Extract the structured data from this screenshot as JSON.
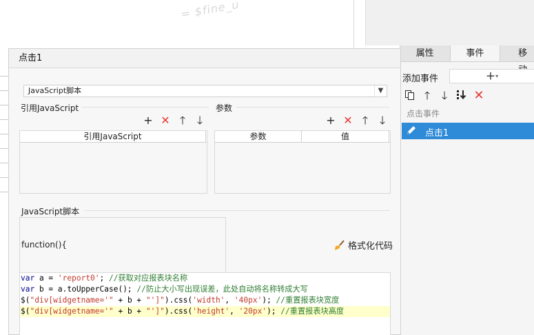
{
  "background": {
    "watermark": "= $fine_u"
  },
  "right_panel": {
    "tabs": [
      "属性",
      "事件",
      "移动"
    ],
    "active_tab": "事件",
    "add_event_label": "添加事件",
    "add_event_button": "+",
    "toolbar_icons": [
      "copy-icon",
      "arrow-up-icon",
      "arrow-down-icon",
      "move-bottom-icon",
      "delete-icon"
    ],
    "section_label": "点击事件",
    "events": [
      {
        "label": "点击1",
        "selected": true
      }
    ],
    "selection_color": "#2f8bd8"
  },
  "dialog": {
    "title": "点击1",
    "type_select": {
      "value": "JavaScript脚本"
    },
    "ref_js": {
      "section_label": "引用JavaScript",
      "column": "引用JavaScript"
    },
    "params": {
      "section_label": "参数",
      "columns": [
        "参数",
        "值"
      ]
    },
    "script": {
      "section_label": "JavaScript脚本",
      "function_header": "function(){",
      "format_button": "格式化代码",
      "code_lines": [
        [
          {
            "t": "var",
            "c": "kw"
          },
          {
            "t": " a = ",
            "c": "fnname"
          },
          {
            "t": "'report0'",
            "c": "str"
          },
          {
            "t": "; ",
            "c": "fnname"
          },
          {
            "t": "//获取对应报表块名称",
            "c": "cm"
          }
        ],
        [
          {
            "t": "var",
            "c": "kw"
          },
          {
            "t": " b = a.toUpperCase(); ",
            "c": "fnname"
          },
          {
            "t": "//防止大小写出现误差，此处自动将名称转成大写",
            "c": "cm"
          }
        ],
        [
          {
            "t": "$(",
            "c": "fnname"
          },
          {
            "t": "\"div[widgetname='\"",
            "c": "str"
          },
          {
            "t": " + b + ",
            "c": "fnname"
          },
          {
            "t": "\"']\"",
            "c": "str"
          },
          {
            "t": ").css(",
            "c": "fnname"
          },
          {
            "t": "'width'",
            "c": "str"
          },
          {
            "t": ", ",
            "c": "fnname"
          },
          {
            "t": "'40px'",
            "c": "str"
          },
          {
            "t": "); ",
            "c": "fnname"
          },
          {
            "t": "//重置报表块宽度",
            "c": "cm"
          }
        ],
        [
          {
            "t": "$(",
            "c": "fnname"
          },
          {
            "t": "\"div[widgetname='\"",
            "c": "str"
          },
          {
            "t": " + b + ",
            "c": "fnname"
          },
          {
            "t": "\"']\"",
            "c": "str"
          },
          {
            "t": ").css(",
            "c": "fnname"
          },
          {
            "t": "'height'",
            "c": "str"
          },
          {
            "t": ", ",
            "c": "fnname"
          },
          {
            "t": "'20px'",
            "c": "str"
          },
          {
            "t": "); ",
            "c": "fnname"
          },
          {
            "t": "//重置报表块高度",
            "c": "cm"
          }
        ]
      ],
      "highlighted_line": 3
    }
  }
}
